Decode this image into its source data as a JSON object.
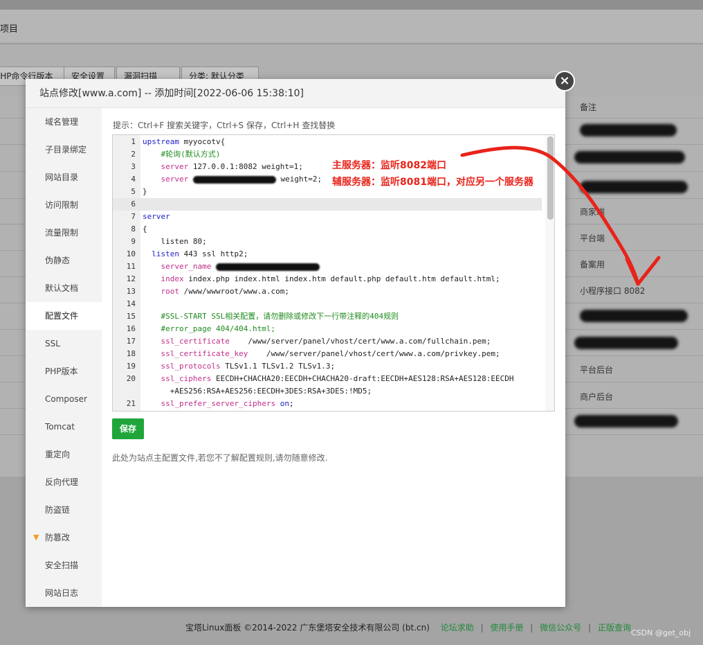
{
  "background": {
    "header_text": "项目",
    "toolbar_buttons": [
      "PHP命令行版本",
      "安全设置",
      "漏洞扫描",
      "分类: 默认分类"
    ],
    "column_header": "备注",
    "notes": [
      "商家端",
      "平台端",
      "备案用",
      "小程序接口 8082",
      "平台后台",
      "商户后台"
    ]
  },
  "modal": {
    "title": "站点修改[www.a.com] -- 添加时间[2022-06-06 15:38:10]",
    "close_label": "×",
    "sidebar": [
      {
        "label": "域名管理",
        "active": false
      },
      {
        "label": "子目录绑定",
        "active": false
      },
      {
        "label": "网站目录",
        "active": false
      },
      {
        "label": "访问限制",
        "active": false
      },
      {
        "label": "流量限制",
        "active": false
      },
      {
        "label": "伪静态",
        "active": false
      },
      {
        "label": "默认文档",
        "active": false
      },
      {
        "label": "配置文件",
        "active": true
      },
      {
        "label": "SSL",
        "active": false
      },
      {
        "label": "PHP版本",
        "active": false
      },
      {
        "label": "Composer",
        "active": false
      },
      {
        "label": "Tomcat",
        "active": false
      },
      {
        "label": "重定向",
        "active": false
      },
      {
        "label": "反向代理",
        "active": false
      },
      {
        "label": "防盗链",
        "active": false
      },
      {
        "label": "防篡改",
        "active": false,
        "icon": "gem-icon"
      },
      {
        "label": "安全扫描",
        "active": false
      },
      {
        "label": "网站日志",
        "active": false
      }
    ],
    "tip": "提示：Ctrl+F 搜索关键字，Ctrl+S 保存，Ctrl+H 查找替换",
    "code_lines": [
      {
        "n": "1",
        "t": "upstream myyocotv{"
      },
      {
        "n": "2",
        "t": "    #轮询(默认方式)"
      },
      {
        "n": "3",
        "t": "    server 127.0.0.1:8082 weight=1;"
      },
      {
        "n": "4",
        "t": "    server "
      },
      {
        "n": "4b",
        "t": "weight=2;"
      },
      {
        "n": "5",
        "t": "}"
      },
      {
        "n": "6",
        "t": ""
      },
      {
        "n": "7",
        "t": "server"
      },
      {
        "n": "8",
        "t": "{"
      },
      {
        "n": "9",
        "t": "    listen 80;"
      },
      {
        "n": "10",
        "t": "  listen 443 ssl http2;"
      },
      {
        "n": "11",
        "t": "    server_name "
      },
      {
        "n": "12",
        "t": "    index index.php index.html index.htm default.php default.htm default.html;"
      },
      {
        "n": "13",
        "t": "    root /www/wwwroot/www.a.com;"
      },
      {
        "n": "14",
        "t": ""
      },
      {
        "n": "15",
        "t": "    #SSL-START SSL相关配置，请勿删除或修改下一行带注释的404规则"
      },
      {
        "n": "16",
        "t": "    #error_page 404/404.html;"
      },
      {
        "n": "17",
        "t": "    ssl_certificate    /www/server/panel/vhost/cert/www.a.com/fullchain.pem;"
      },
      {
        "n": "18",
        "t": "    ssl_certificate_key    /www/server/panel/vhost/cert/www.a.com/privkey.pem;"
      },
      {
        "n": "19",
        "t": "    ssl_protocols TLSv1.1 TLSv1.2 TLSv1.3;"
      },
      {
        "n": "20",
        "t": "    ssl_ciphers EECDH+CHACHA20:EECDH+CHACHA20-draft:EECDH+AES128:RSA+AES128:EECDH"
      },
      {
        "n": "20b",
        "t": "      +AES256:RSA+AES256:EECDH+3DES:RSA+3DES:!MD5;"
      },
      {
        "n": "21",
        "t": "    ssl_prefer_server_ciphers on;"
      }
    ],
    "save_label": "保存",
    "note": "此处为站点主配置文件,若您不了解配置规则,请勿随意修改."
  },
  "annotations": {
    "primary": "主服务器：监听8082端口",
    "secondary": "辅服务器：监听8081端口，对应另一个服务器"
  },
  "footer": {
    "copyright": "宝塔Linux面板 ©2014-2022 广东堡塔安全技术有限公司 (bt.cn)",
    "links": [
      "论坛求助",
      "使用手册",
      "微信公众号",
      "正版查询"
    ],
    "watermark": "CSDN @get_obj"
  },
  "colors": {
    "accent_green": "#20a53a",
    "annotation_red": "#e8231a"
  }
}
